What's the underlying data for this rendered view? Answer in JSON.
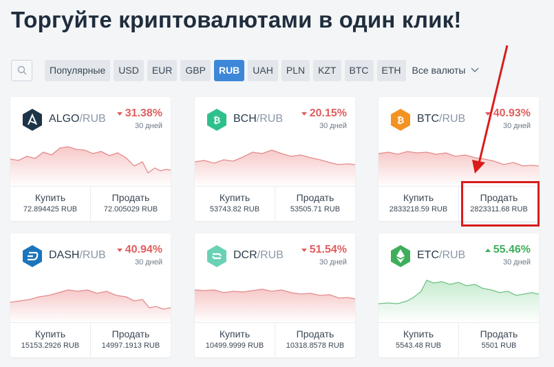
{
  "page": {
    "title": "Торгуйте криптовалютами в один клик!"
  },
  "filters": {
    "chips": [
      "Популярные",
      "USD",
      "EUR",
      "GBP",
      "RUB",
      "UAH",
      "PLN",
      "KZT",
      "BTC",
      "ETH"
    ],
    "active": "RUB",
    "all_label": "Все валюты"
  },
  "labels": {
    "buy": "Купить",
    "sell": "Продать"
  },
  "colors": {
    "down": "#e05d5d",
    "up": "#3fae5b",
    "accent": "#3d87d8",
    "highlight": "#d91b1b"
  },
  "cards": [
    {
      "base": "ALGO",
      "quote": "/RUB",
      "change": "31.38%",
      "dir": "down",
      "period": "30 дней",
      "buy": "72.894425 RUB",
      "sell": "72.005029 RUB",
      "icon": "algo-icon",
      "icon_color": "#1d3448"
    },
    {
      "base": "BCH",
      "quote": "/RUB",
      "change": "20.15%",
      "dir": "down",
      "period": "30 дней",
      "buy": "53743.82 RUB",
      "sell": "53505.71 RUB",
      "icon": "bch-icon",
      "icon_color": "#2fbf8c"
    },
    {
      "base": "BTC",
      "quote": "/RUB",
      "change": "40.93%",
      "dir": "down",
      "period": "30 дней",
      "buy": "2833218.59 RUB",
      "sell": "2823311.68 RUB",
      "icon": "btc-icon",
      "icon_color": "#f39321"
    },
    {
      "base": "DASH",
      "quote": "/RUB",
      "change": "40.94%",
      "dir": "down",
      "period": "30 дней",
      "buy": "15153.2926 RUB",
      "sell": "14997.1913 RUB",
      "icon": "dash-icon",
      "icon_color": "#1b75bc"
    },
    {
      "base": "DCR",
      "quote": "/RUB",
      "change": "51.54%",
      "dir": "down",
      "period": "30 дней",
      "buy": "10499.9999 RUB",
      "sell": "10318.8578 RUB",
      "icon": "dcr-icon",
      "icon_color": "#6bd1b6"
    },
    {
      "base": "ETC",
      "quote": "/RUB",
      "change": "55.46%",
      "dir": "up",
      "period": "30 дней",
      "buy": "5543.48 RUB",
      "sell": "5501 RUB",
      "icon": "etc-icon",
      "icon_color": "#3fae5b"
    }
  ]
}
